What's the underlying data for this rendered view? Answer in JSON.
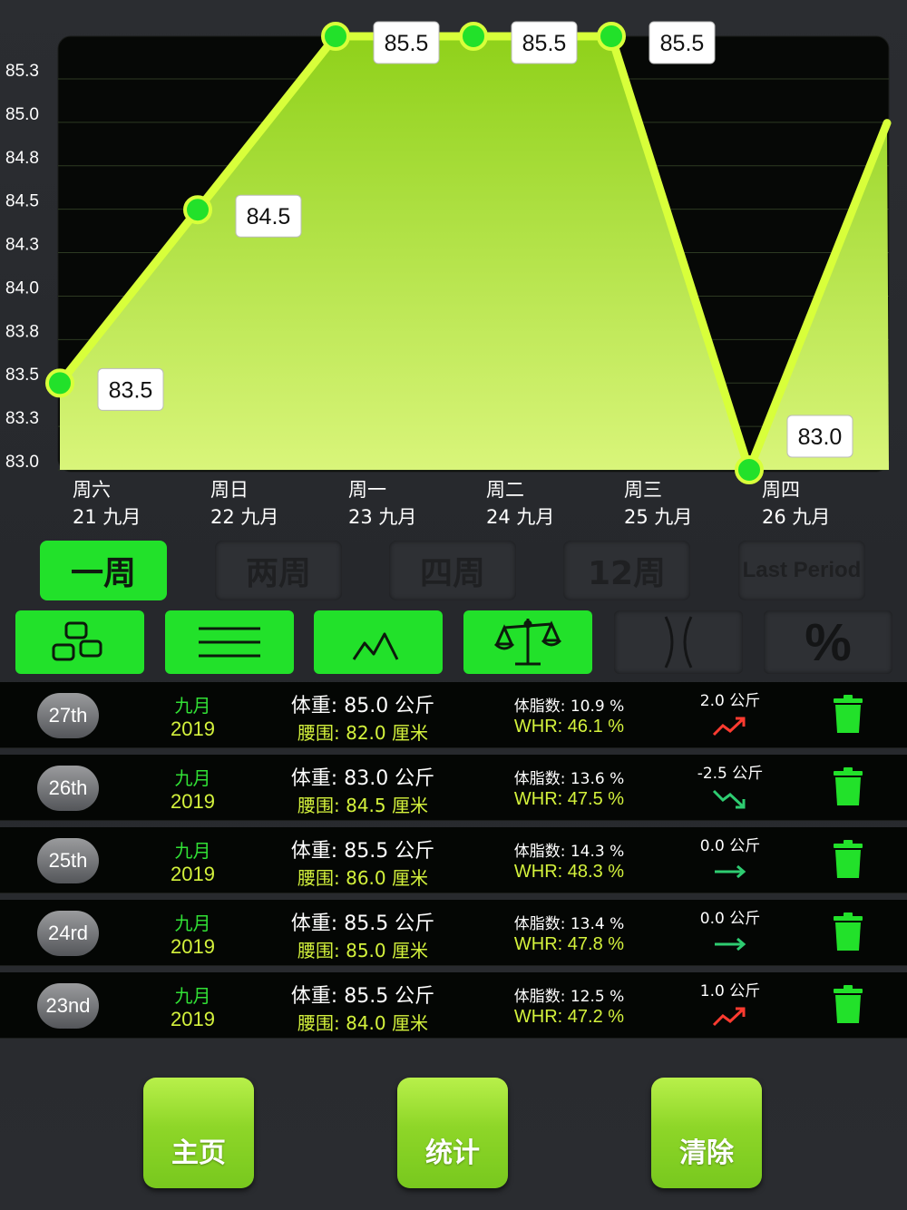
{
  "chart_data": {
    "type": "area",
    "x": [
      "周六 21 九月",
      "周日 22 九月",
      "周一 23 九月",
      "周二 24 九月",
      "周三 25 九月",
      "周四 26 九月"
    ],
    "x_day_labels": [
      "周六",
      "周日",
      "周一",
      "周二",
      "周三",
      "周四"
    ],
    "x_date_labels": [
      "21 九月",
      "22 九月",
      "23 九月",
      "24 九月",
      "25 九月",
      "26 九月"
    ],
    "series": [
      {
        "values": [
          83.5,
          84.5,
          85.5,
          85.5,
          85.5,
          83.0,
          85.0
        ]
      }
    ],
    "point_labels": [
      "83.5",
      "84.5",
      "85.5",
      "85.5",
      "85.5",
      "83.0"
    ],
    "y_ticks": [
      "85.3",
      "85.0",
      "84.8",
      "84.5",
      "84.3",
      "84.0",
      "83.8",
      "83.5",
      "83.3",
      "83.0"
    ],
    "ylim": [
      83.0,
      85.5
    ],
    "grid": true,
    "fill_color": "#9bdc1a",
    "line_color": "#d8ff3a",
    "point_color": "#22e12a"
  },
  "period_buttons": [
    {
      "label": "一周",
      "active": true
    },
    {
      "label": "两周",
      "active": false
    },
    {
      "label": "四周",
      "active": false
    },
    {
      "label": "12周",
      "active": false
    },
    {
      "label": "Last Period",
      "active": false
    }
  ],
  "view_buttons": [
    {
      "icon": "blocks-icon",
      "active": true
    },
    {
      "icon": "lines-icon",
      "active": true
    },
    {
      "icon": "line-chart-icon",
      "active": true
    },
    {
      "icon": "scale-icon",
      "active": true
    },
    {
      "icon": "waist-icon",
      "active": false
    },
    {
      "icon": "percent-icon",
      "active": false
    }
  ],
  "percent_symbol": "%",
  "entries": [
    {
      "day": "27th",
      "month": "九月",
      "year": "2019",
      "weight": "体重: 85.0 公斤",
      "waist": "腰围: 82.0 厘米",
      "fat": "体脂数: 10.9 %",
      "whr": "WHR: 46.1 %",
      "delta": "2.0 公斤",
      "trend": "up"
    },
    {
      "day": "26th",
      "month": "九月",
      "year": "2019",
      "weight": "体重: 83.0 公斤",
      "waist": "腰围: 84.5 厘米",
      "fat": "体脂数: 13.6 %",
      "whr": "WHR: 47.5 %",
      "delta": "-2.5 公斤",
      "trend": "down"
    },
    {
      "day": "25th",
      "month": "九月",
      "year": "2019",
      "weight": "体重: 85.5 公斤",
      "waist": "腰围: 86.0 厘米",
      "fat": "体脂数: 14.3 %",
      "whr": "WHR: 48.3 %",
      "delta": "0.0 公斤",
      "trend": "flat"
    },
    {
      "day": "24rd",
      "month": "九月",
      "year": "2019",
      "weight": "体重: 85.5 公斤",
      "waist": "腰围: 85.0 厘米",
      "fat": "体脂数: 13.4 %",
      "whr": "WHR: 47.8 %",
      "delta": "0.0 公斤",
      "trend": "flat"
    },
    {
      "day": "23nd",
      "month": "九月",
      "year": "2019",
      "weight": "体重: 85.5 公斤",
      "waist": "腰围: 84.0 厘米",
      "fat": "体脂数: 12.5 %",
      "whr": "WHR: 47.2 %",
      "delta": "1.0 公斤",
      "trend": "up"
    }
  ],
  "nav": {
    "home": "主页",
    "stats": "统计",
    "clear": "清除"
  },
  "colors": {
    "accent": "#22e12a",
    "yellow_green": "#d4f23c",
    "trend_up": "#ff3b30",
    "trend_down": "#2ecc71"
  }
}
